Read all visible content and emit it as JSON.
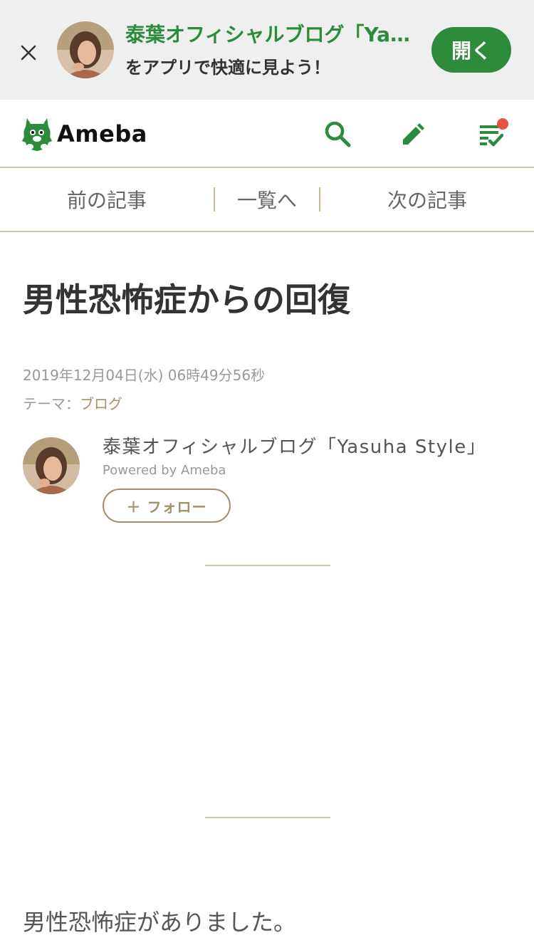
{
  "app_banner": {
    "title": "泰葉オフィシャルブログ「Yasuha Style」",
    "subtitle": "をアプリで快適に見よう！",
    "open_label": "開く",
    "accent_color": "#2d8c3c"
  },
  "header": {
    "logo_text": "Ameba",
    "icons": [
      "search-icon",
      "pencil-icon",
      "checklist-icon"
    ],
    "has_notification": true
  },
  "article_nav": {
    "prev_label": "前の記事",
    "list_label": "一覧へ",
    "next_label": "次の記事"
  },
  "article": {
    "title": "男性恐怖症からの回復",
    "date": "2019年12月04日(水) 06時49分56秒",
    "theme_label": "テーマ：",
    "theme_value": "ブログ",
    "body_first_line": "男性恐怖症がありました。"
  },
  "author": {
    "name": "泰葉オフィシャルブログ「Yasuha Style」",
    "powered_by": "Powered by Ameba",
    "follow_label": "＋ フォロー"
  },
  "colors": {
    "accent_green": "#2d8c3c",
    "accent_gold": "#a2916b",
    "notification": "#e8533f"
  }
}
